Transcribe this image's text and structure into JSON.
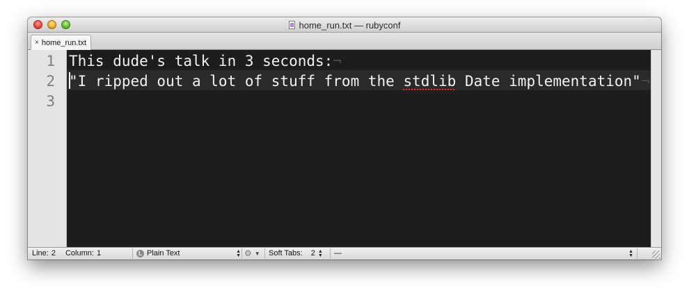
{
  "window": {
    "title": "home_run.txt — rubyconf",
    "doc_icon": "text-document-icon"
  },
  "tabs": [
    {
      "label": "home_run.txt",
      "close_glyph": "×"
    }
  ],
  "editor": {
    "line_numbers": [
      "1",
      "2",
      "3"
    ],
    "lines": {
      "l1": "This dude's talk in 3 seconds:",
      "l2_a": "\"I ripped out a lot of stuff from the ",
      "l2_misspelt": "stdlib",
      "l2_b": " Date implementation\""
    },
    "invisibles_glyph": "¬",
    "theme": {
      "background": "#1d1d1e",
      "text": "#f2f2f2",
      "current_line": "#2a2a2b",
      "spell_error": "#e33232"
    }
  },
  "statusbar": {
    "line_label": "Line:",
    "line_value": "2",
    "column_label": "Column:",
    "column_value": "1",
    "language": "Plain Text",
    "language_badge": "L",
    "soft_tabs_label": "Soft Tabs:",
    "soft_tabs_value": "2",
    "symbol": "—"
  }
}
